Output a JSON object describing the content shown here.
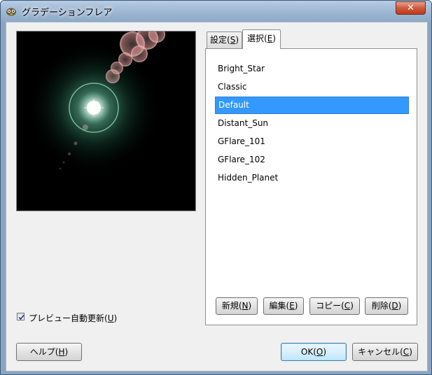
{
  "window": {
    "title": "グラデーションフレア",
    "close_label": "✕"
  },
  "preview_option": {
    "label": "プレビュー自動更新(",
    "mnemonic": "U",
    "suffix": ")",
    "checked": true
  },
  "tabs": [
    {
      "label": "設定(",
      "mnemonic": "S",
      "suffix": ")",
      "active": false
    },
    {
      "label": "選択(",
      "mnemonic": "E",
      "suffix": ")",
      "active": true
    }
  ],
  "flare_list": {
    "items": [
      "Bright_Star",
      "Classic",
      "Default",
      "Distant_Sun",
      "GFlare_101",
      "GFlare_102",
      "Hidden_Planet"
    ],
    "selected": "Default"
  },
  "list_buttons": {
    "new": {
      "label": "新規(",
      "mnemonic": "N",
      "suffix": ")"
    },
    "edit": {
      "label": "編集(",
      "mnemonic": "E",
      "suffix": ")"
    },
    "copy": {
      "label": "コピー(",
      "mnemonic": "C",
      "suffix": ")"
    },
    "delete": {
      "label": "削除(",
      "mnemonic": "D",
      "suffix": ")"
    }
  },
  "dialog_buttons": {
    "help": {
      "label": "ヘルプ(",
      "mnemonic": "H",
      "suffix": ")"
    },
    "ok": {
      "label": "OK(",
      "mnemonic": "O",
      "suffix": ")"
    },
    "cancel": {
      "label": "キャンセル(",
      "mnemonic": "C",
      "suffix": ")"
    }
  },
  "colors": {
    "selection": "#3399ff",
    "flare_glow": "#2f8a6a",
    "flare_ring": "#7fd0b0",
    "flare_rays": "#e9a3a3"
  }
}
